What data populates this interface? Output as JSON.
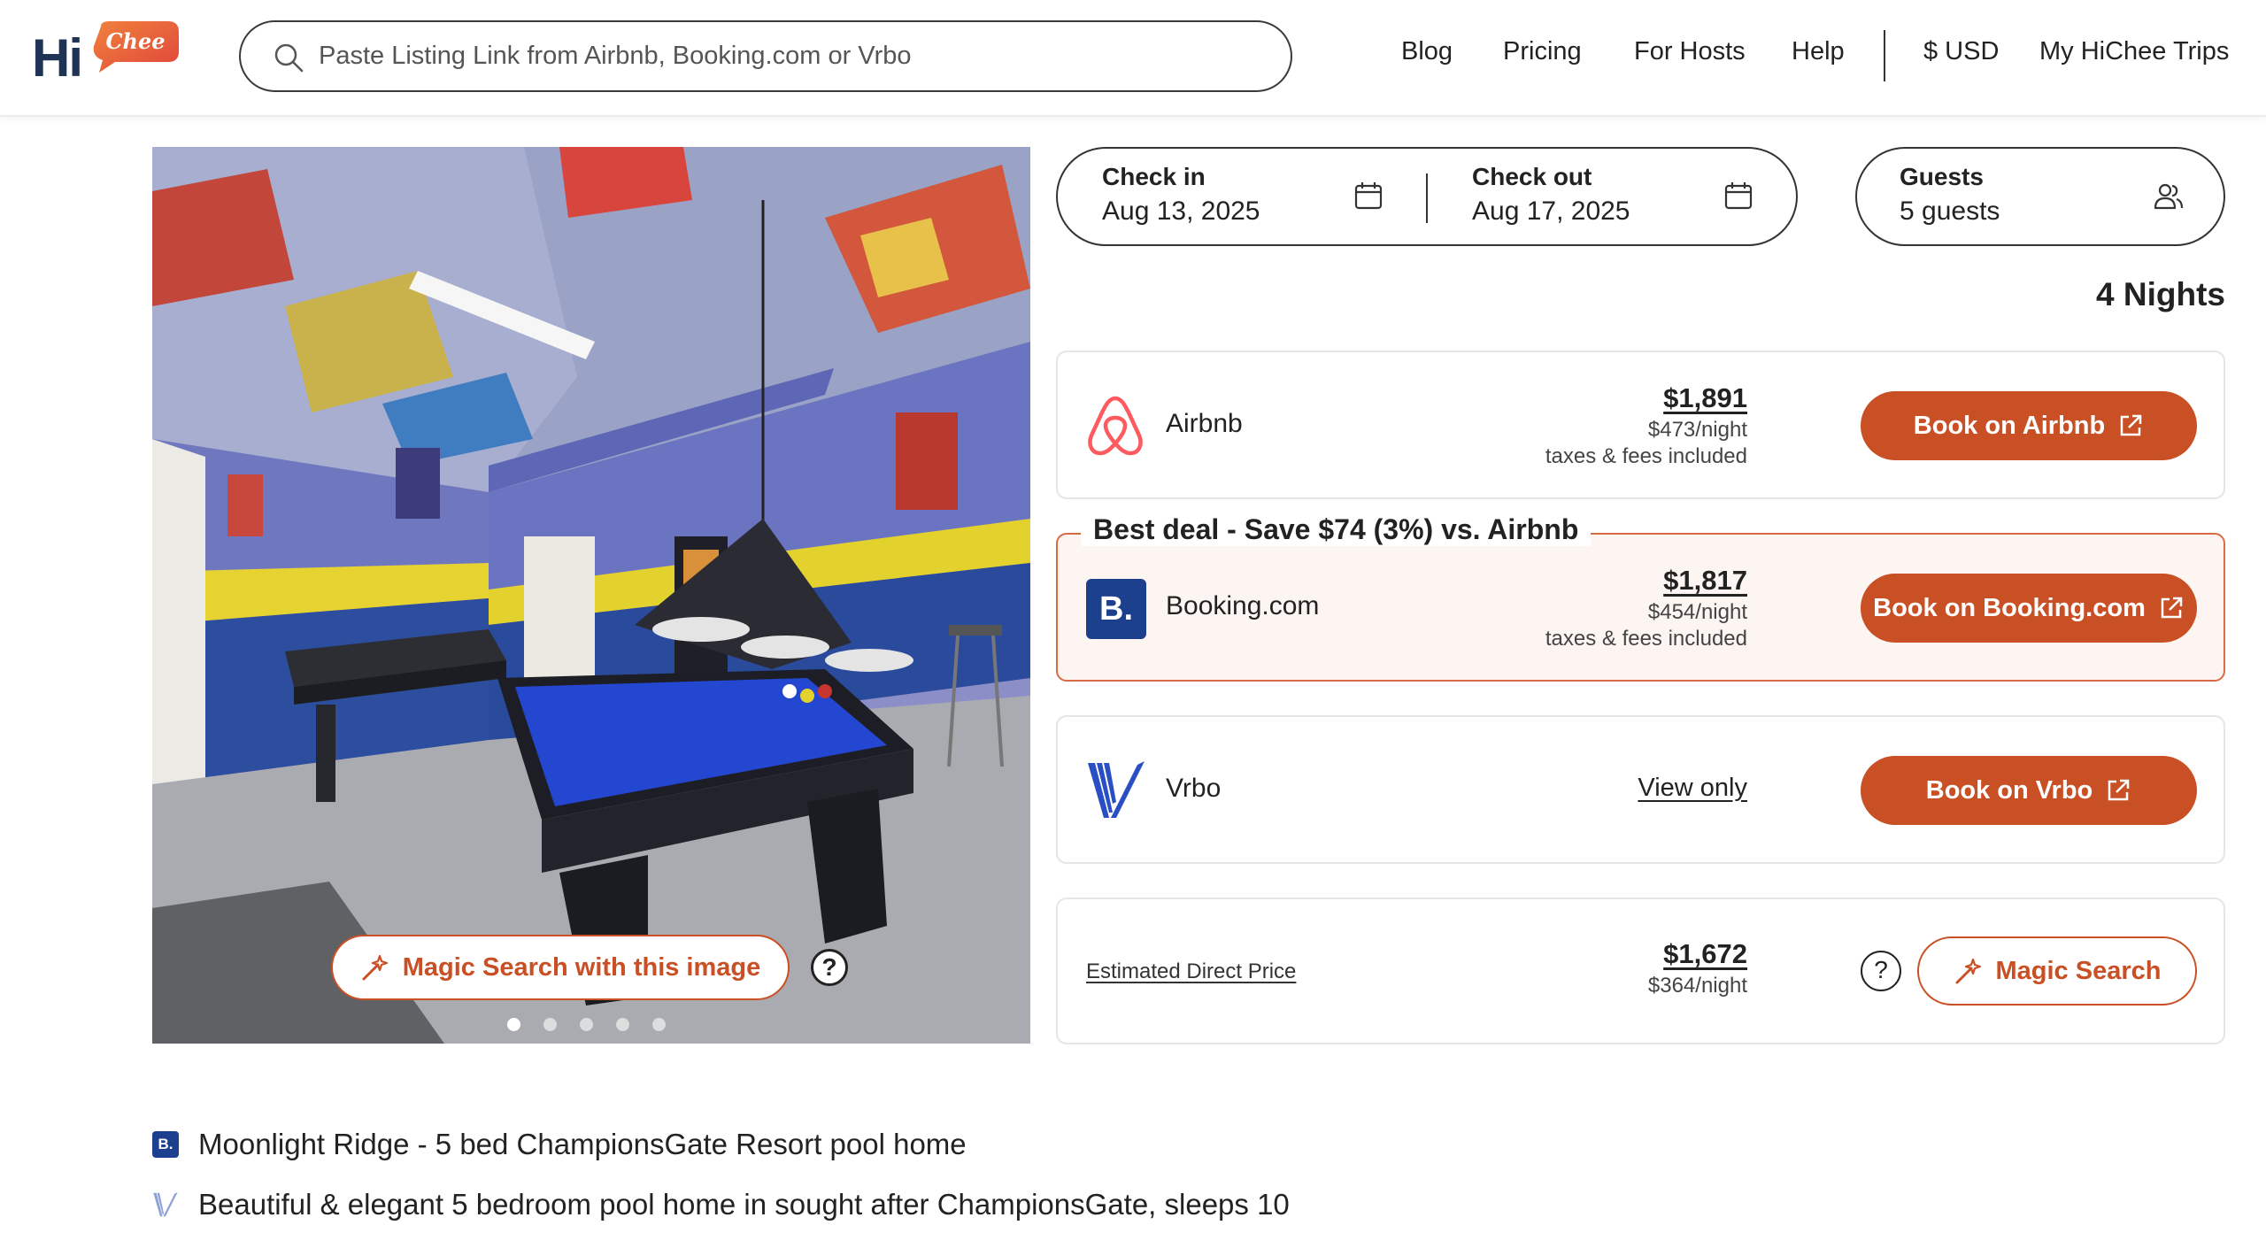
{
  "header": {
    "logo_text": "Hi",
    "logo_accent": "Chee",
    "search_placeholder": "Paste Listing Link from Airbnb, Booking.com or Vrbo",
    "nav": {
      "blog": "Blog",
      "pricing": "Pricing",
      "for_hosts": "For Hosts",
      "help": "Help",
      "currency": "$ USD",
      "trips": "My HiChee Trips"
    }
  },
  "gallery": {
    "magic_search_label": "Magic Search with this image",
    "help_label": "?",
    "slide_count": 5,
    "active_slide": 1
  },
  "booking": {
    "check_in_label": "Check in",
    "check_in_value": "Aug 13, 2025",
    "check_out_label": "Check out",
    "check_out_value": "Aug 17, 2025",
    "guests_label": "Guests",
    "guests_value": "5 guests",
    "nights": "4 Nights"
  },
  "offers": {
    "airbnb": {
      "name": "Airbnb",
      "total": "$1,891",
      "per_night": "$473/night",
      "fees": "taxes & fees included",
      "button": "Book on Airbnb"
    },
    "booking": {
      "best_deal": "Best deal - Save $74 (3%) vs. Airbnb",
      "name": "Booking.com",
      "total": "$1,817",
      "per_night": "$454/night",
      "fees": "taxes & fees included",
      "button": "Book on Booking.com",
      "badge": "B."
    },
    "vrbo": {
      "name": "Vrbo",
      "view_only": "View only",
      "button": "Book on Vrbo"
    },
    "direct": {
      "label": "Estimated Direct Price",
      "total": "$1,672",
      "per_night": "$364/night",
      "help": "?",
      "button": "Magic Search"
    }
  },
  "titles": {
    "booking_title": "Moonlight Ridge - 5 bed ChampionsGate Resort pool home",
    "booking_badge": "B.",
    "vrbo_title": "Beautiful & elegant 5 bedroom pool home in sought after ChampionsGate, sleeps 10"
  },
  "colors": {
    "accent": "#c94f24",
    "airbnb": "#ff5a5f",
    "booking": "#1c3f8e",
    "vrbo": "#2a4ec4",
    "best_deal_bg": "#fdf5f1"
  }
}
